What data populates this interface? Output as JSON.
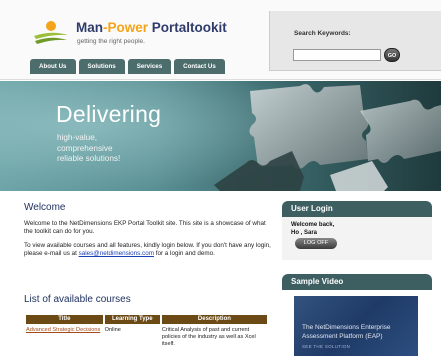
{
  "header": {
    "logo": {
      "title_part1": "Man",
      "title_dash": "-",
      "title_part2": "Power",
      "title_part3": " Portaltookit",
      "tagline": "getting the right people."
    },
    "nav": [
      {
        "label": "About Us"
      },
      {
        "label": "Solutions"
      },
      {
        "label": "Services"
      },
      {
        "label": "Contact Us"
      }
    ],
    "search": {
      "label": "Search Keywords:",
      "value": "",
      "go_label": "GO"
    }
  },
  "banner": {
    "headline": "Delivering",
    "sub_lines": [
      "high-value,",
      "comprehensive",
      "reliable solutions!"
    ]
  },
  "main": {
    "welcome_title": "Welcome",
    "welcome_p1": "Welcome to the NetDimensions EKP Portal Toolkit site. This site is a showcase of what the toolkit can do for you.",
    "welcome_p2_before": "To view available courses and all features, kindly login below. If you don't have any login, please e-mail us at ",
    "welcome_email": "sales@netdimensions.com",
    "welcome_p2_after": " for a login and demo.",
    "courses_title": "List of available courses",
    "courses_table": {
      "headers": [
        "Title",
        "Learning Type",
        "Description"
      ],
      "rows": [
        {
          "title": "Advanced Strategic Decisions",
          "learning_type": "Online",
          "description": "Critical Analysis of past and current policies of the industry as well as Xcel itself."
        }
      ]
    }
  },
  "sidebar": {
    "login": {
      "heading": "User Login",
      "welcome_line1": "Welcome back,",
      "welcome_line2": "Ho , Sara",
      "logoff_label": "LOG OFF"
    },
    "video": {
      "heading": "Sample Video",
      "caption_line1": "The NetDimensions Enterprise",
      "caption_line2": "Assessment Platform (EAP)",
      "caption_sub": "SEE THE SOLUTION"
    }
  },
  "colors": {
    "nav_tab": "#4d6d6d",
    "panel_head": "#3d5f62",
    "table_header": "#6b4a16",
    "heading_text": "#1c2f5d",
    "accent_orange": "#f3a41a",
    "link_blue": "#1a3fb3"
  }
}
